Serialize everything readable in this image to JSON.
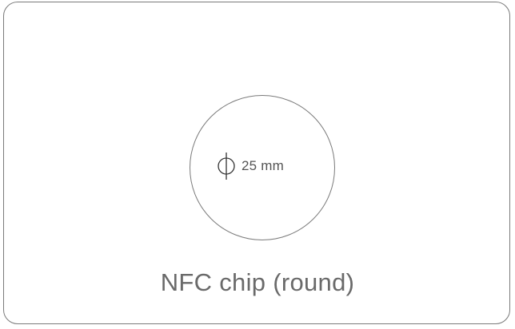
{
  "diagram": {
    "dimension": {
      "symbol": "diameter-icon",
      "value": "25 mm"
    },
    "caption": "NFC chip (round)",
    "colors": {
      "outline": "#7a7a7a",
      "text": "#6a6a6a"
    }
  }
}
